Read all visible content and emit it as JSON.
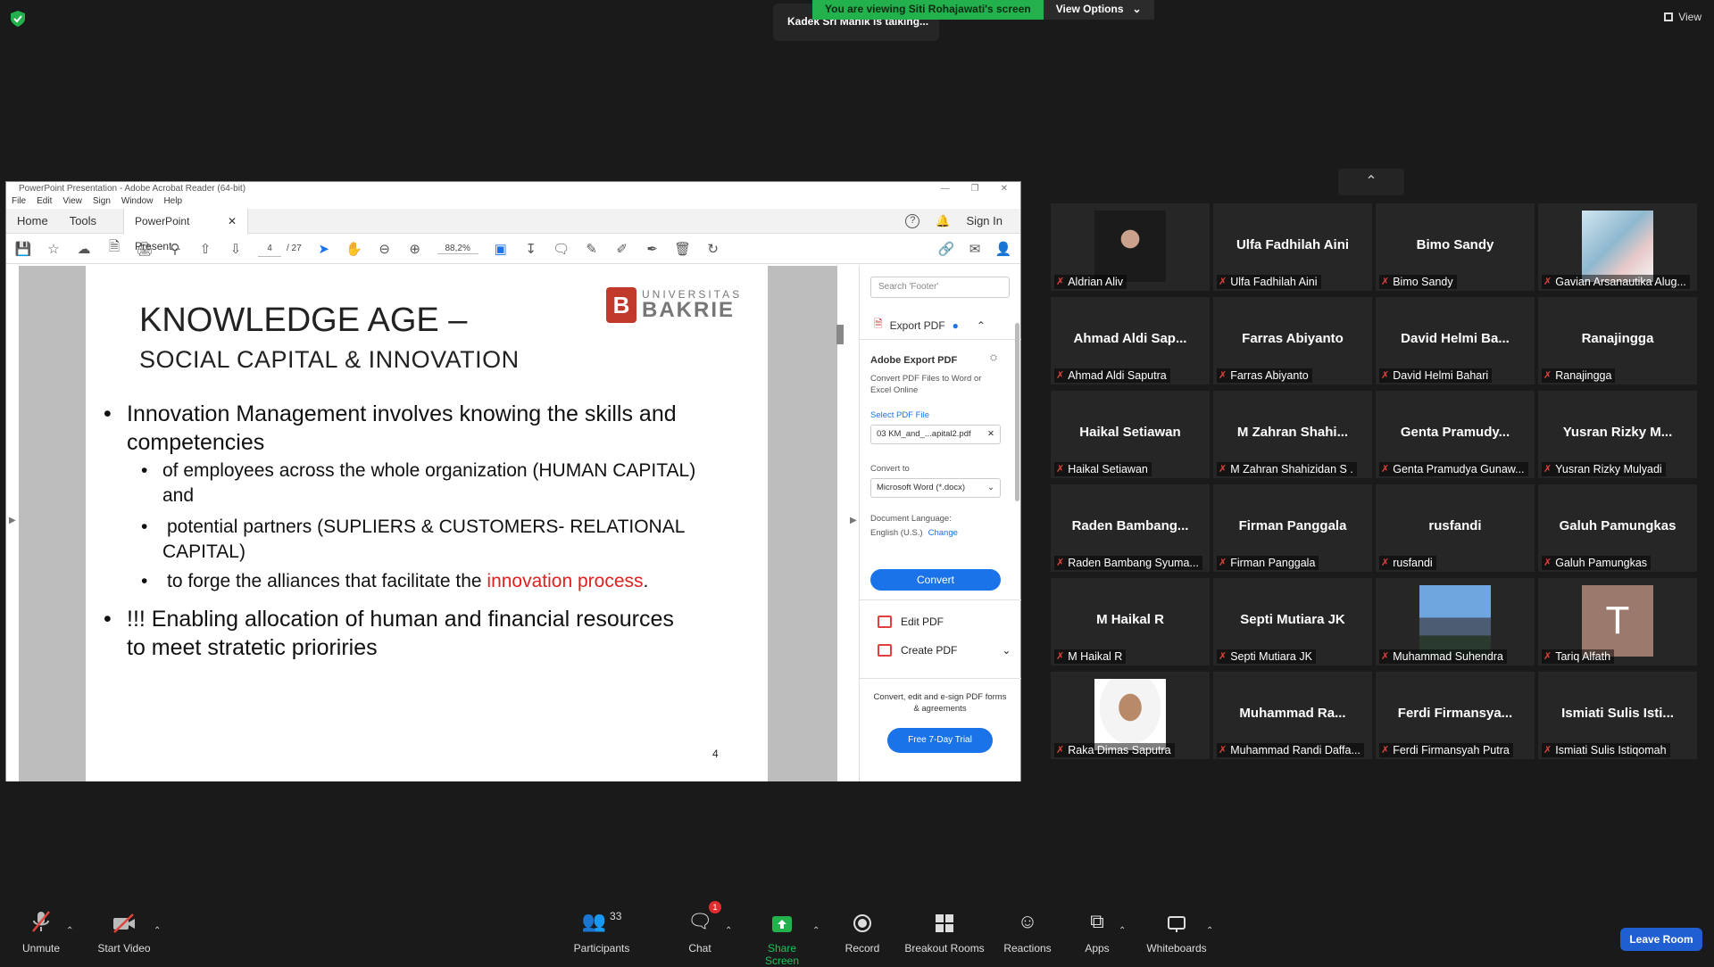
{
  "banner": {
    "viewing": "You are viewing Siti Rohajawati's screen",
    "view_options": "View Options",
    "talking": "Kadek Sri Manik is talking...",
    "view_label": "View"
  },
  "acrobat": {
    "title": "PowerPoint Presentation - Adobe Acrobat Reader (64-bit)",
    "menu": [
      "File",
      "Edit",
      "View",
      "Sign",
      "Window",
      "Help"
    ],
    "tab_home": "Home",
    "tab_tools": "Tools",
    "tab_doc": "PowerPoint Present...",
    "sign_in": "Sign In",
    "page_current": "4",
    "page_total": "/ 27",
    "zoom": "88,2%",
    "slide": {
      "logo_line1": "UNIVERSITAS",
      "logo_line2": "BAKRIE",
      "title": "KNOWLEDGE AGE –",
      "subtitle": "SOCIAL CAPITAL & INNOVATION",
      "bullet1_l1": "Innovation Management involves knowing the skills and",
      "bullet1_l2": "competencies",
      "sub1_l1": "of employees across the whole organization (HUMAN CAPITAL)",
      "sub1_l2": "and",
      "sub2_l1": "potential partners (SUPLIERS & CUSTOMERS- RELATIONAL",
      "sub2_l2": "CAPITAL)",
      "sub3_pre": "to forge the alliances that facilitate the",
      "sub3_red": "innovation process",
      "sub3_post": ".",
      "bullet2_l1": "!!! Enabling allocation  of human and financial resources",
      "bullet2_l2": "to meet stratetic prioriries",
      "page_number": "4"
    },
    "panel": {
      "search_placeholder": "Search 'Footer'",
      "export_header": "Export PDF",
      "ae_title": "Adobe Export PDF",
      "ae_desc": "Convert PDF Files to Word or Excel Online",
      "select_file": "Select PDF File",
      "file_name": "03 KM_and_...apital2.pdf",
      "convert_to": "Convert to",
      "convert_option": "Microsoft Word (*.docx)",
      "doc_lang_label": "Document Language:",
      "doc_lang": "English (U.S.)",
      "change": "Change",
      "convert_button": "Convert",
      "edit_pdf": "Edit PDF",
      "create_pdf": "Create PDF",
      "promo": "Convert, edit and e-sign PDF forms & agreements",
      "trial": "Free 7-Day Trial"
    }
  },
  "participants": [
    {
      "tile_name": "",
      "label": "Aldrian Aliv",
      "photo": "person-dark"
    },
    {
      "tile_name": "Ulfa Fadhilah Aini",
      "label": "Ulfa Fadhilah Aini"
    },
    {
      "tile_name": "Bimo Sandy",
      "label": "Bimo Sandy"
    },
    {
      "tile_name": "",
      "label": "Gavian Arsanautika Alug...",
      "photo": "anime"
    },
    {
      "tile_name": "Ahmad Aldi Sap...",
      "label": "Ahmad Aldi Saputra"
    },
    {
      "tile_name": "Farras Abiyanto",
      "label": "Farras Abiyanto"
    },
    {
      "tile_name": "David Helmi Ba...",
      "label": "David Helmi Bahari"
    },
    {
      "tile_name": "Ranajingga",
      "label": "Ranajingga"
    },
    {
      "tile_name": "Haikal Setiawan",
      "label": "Haikal Setiawan"
    },
    {
      "tile_name": "M Zahran Shahi...",
      "label": "M Zahran Shahizidan S ."
    },
    {
      "tile_name": "Genta Pramudy...",
      "label": "Genta Pramudya Gunaw..."
    },
    {
      "tile_name": "Yusran Rizky M...",
      "label": "Yusran Rizky Mulyadi"
    },
    {
      "tile_name": "Raden Bambang...",
      "label": "Raden Bambang Syuma..."
    },
    {
      "tile_name": "Firman Panggala",
      "label": "Firman Panggala"
    },
    {
      "tile_name": "rusfandi",
      "label": "rusfandi"
    },
    {
      "tile_name": "Galuh Pamungkas",
      "label": "Galuh Pamungkas"
    },
    {
      "tile_name": "M Haikal R",
      "label": "M Haikal R"
    },
    {
      "tile_name": "Septi Mutiara JK",
      "label": "Septi Mutiara JK"
    },
    {
      "tile_name": "",
      "label": "Muhammad Suhendra",
      "photo": "mountain"
    },
    {
      "tile_name": "",
      "label": "Tariq Alfath",
      "photo": "letter-t",
      "initial": "T"
    },
    {
      "tile_name": "",
      "label": "Raka Dimas Saputra",
      "photo": "person-light"
    },
    {
      "tile_name": "Muhammad Ra...",
      "label": "Muhammad Randi Daffa..."
    },
    {
      "tile_name": "Ferdi Firmansya...",
      "label": "Ferdi Firmansyah Putra"
    },
    {
      "tile_name": "Ismiati Sulis Isti...",
      "label": "Ismiati Sulis Istiqomah"
    }
  ],
  "bottombar": {
    "unmute": "Unmute",
    "start_video": "Start Video",
    "participants": "Participants",
    "participants_count": "33",
    "chat": "Chat",
    "chat_badge": "1",
    "share_screen": "Share Screen",
    "record": "Record",
    "breakout": "Breakout Rooms",
    "reactions": "Reactions",
    "apps": "Apps",
    "whiteboards": "Whiteboards",
    "leave": "Leave Room"
  },
  "colors": {
    "share_green": "#22b14c",
    "leave_blue": "#1f5fd1",
    "mute_red": "#e0433a"
  }
}
